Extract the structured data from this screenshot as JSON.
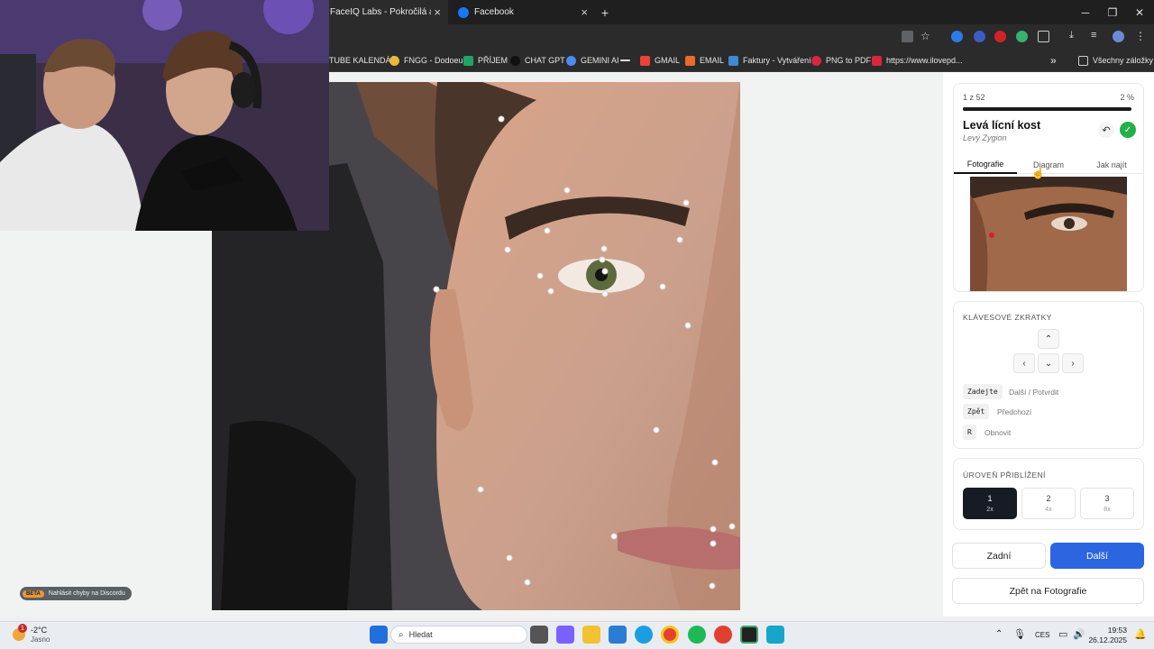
{
  "browser": {
    "tabs": [
      {
        "label": "FaceIQ Labs - Pokročilá analýza",
        "active": true
      },
      {
        "label": "Facebook",
        "active": false
      }
    ],
    "new_tab": "+",
    "window_controls": {
      "minimize": "─",
      "maximize": "❐",
      "close": "✕"
    },
    "bookmarks": [
      {
        "label": "TUBE KALENDÁŘ",
        "icon": "calendar-icon"
      },
      {
        "label": "FNGG - Dodoeu",
        "icon": "fngg-icon"
      },
      {
        "label": "PŘÍJEM",
        "icon": "sheets-icon"
      },
      {
        "label": "CHAT GPT",
        "icon": "openai-icon"
      },
      {
        "label": "GEMINI AI",
        "icon": "gemini-icon"
      },
      {
        "label": "",
        "icon": "dash-icon"
      },
      {
        "label": "GMAIL",
        "icon": "gmail-icon"
      },
      {
        "label": "EMAIL",
        "icon": "email-icon"
      },
      {
        "label": "Faktury - Vytváření",
        "icon": "invoice-icon"
      },
      {
        "label": "PNG to PDF",
        "icon": "heart-icon"
      },
      {
        "label": "https://www.ilovepd...",
        "icon": "ilovepdf-icon"
      }
    ],
    "more_bookmarks": "»",
    "all_bookmarks": "Všechny záložky"
  },
  "analyzer": {
    "progress": {
      "count": "1 z 52",
      "percent": "2 %",
      "fraction": 0.02
    },
    "landmark": {
      "title": "Levá lícní kost",
      "subtitle": "Levý Zygion"
    },
    "undo_icon": "↶",
    "confirm_icon": "✓",
    "tabs": [
      "Fotografie",
      "Diagram",
      "Jak najít"
    ],
    "active_tab": "Fotografie",
    "shortcuts": {
      "title": "KLÁVESOVÉ ZKRATKY",
      "arrows": {
        "up": "⌃",
        "left": "‹",
        "down": "⌄",
        "right": "›"
      },
      "items": [
        {
          "key": "Zadejte",
          "desc": "Další / Potvrdit"
        },
        {
          "key": "Zpět",
          "desc": "Předchozí"
        },
        {
          "key": "R",
          "desc": "Obnovit"
        }
      ]
    },
    "zoom": {
      "title": "ÚROVEŇ PŘIBLÍŽENÍ",
      "options": [
        {
          "level": "1",
          "factor": "2x",
          "active": true
        },
        {
          "level": "2",
          "factor": "4x",
          "active": false
        },
        {
          "level": "3",
          "factor": "8x",
          "active": false
        }
      ]
    },
    "buttons": {
      "back": "Zadní",
      "next": "Další",
      "back_to_photos": "Zpět na Fotografie"
    },
    "beta": {
      "tag": "BETA",
      "text": "Nahlásit chyby na Discordu"
    }
  },
  "taskbar": {
    "weather": {
      "temp": "-2°C",
      "condition": "Jasno",
      "badge": "1"
    },
    "search_placeholder": "Hledat",
    "language": "CES",
    "time": "19:53",
    "date": "26.12.2025"
  }
}
